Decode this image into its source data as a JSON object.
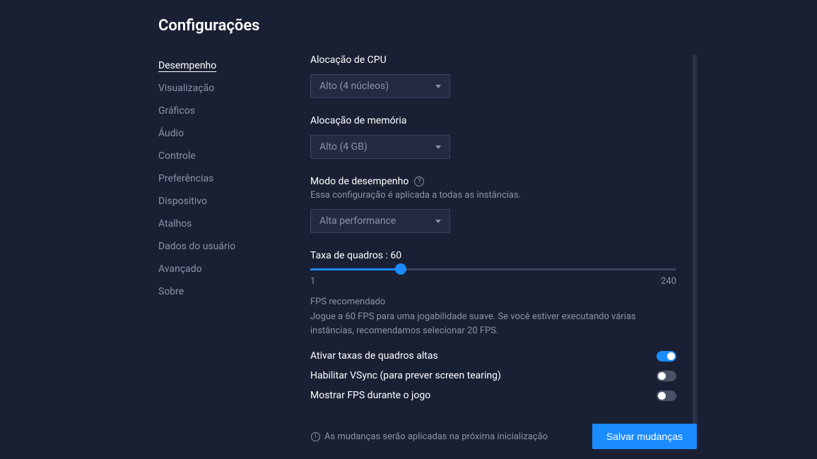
{
  "page_title": "Configurações",
  "sidebar": {
    "items": [
      {
        "label": "Desempenho",
        "active": true
      },
      {
        "label": "Visualização",
        "active": false
      },
      {
        "label": "Gráficos",
        "active": false
      },
      {
        "label": "Áudio",
        "active": false
      },
      {
        "label": "Controle",
        "active": false
      },
      {
        "label": "Preferências",
        "active": false
      },
      {
        "label": "Dispositivo",
        "active": false
      },
      {
        "label": "Atalhos",
        "active": false
      },
      {
        "label": "Dados do usuário",
        "active": false
      },
      {
        "label": "Avançado",
        "active": false
      },
      {
        "label": "Sobre",
        "active": false
      }
    ]
  },
  "cpu_alloc": {
    "label": "Alocação de CPU",
    "value": "Alto (4 núcleos)"
  },
  "mem_alloc": {
    "label": "Alocação de memória",
    "value": "Alto (4 GB)"
  },
  "perf_mode": {
    "label": "Modo de desempenho",
    "sublabel": "Essa configuração é aplicada a todas as instâncias.",
    "value": "Alta performance"
  },
  "fps_slider": {
    "label": "Taxa de quadros : 60",
    "min": "1",
    "max": "240",
    "value": 60
  },
  "fps_info": {
    "title": "FPS recomendado",
    "desc": "Jogue a 60 FPS para uma jogabilidade suave. Se você estiver executando várias instâncias, recomendamos selecionar 20 FPS."
  },
  "toggles": {
    "high_fps": {
      "label": "Ativar taxas de quadros altas",
      "on": true
    },
    "vsync": {
      "label": "Habilitar VSync (para prever screen tearing)",
      "on": false
    },
    "show_fps": {
      "label": "Mostrar FPS durante o jogo",
      "on": false
    }
  },
  "footer": {
    "msg": "As mudanças serão aplicadas na próxima inicialização",
    "save": "Salvar mudanças"
  }
}
